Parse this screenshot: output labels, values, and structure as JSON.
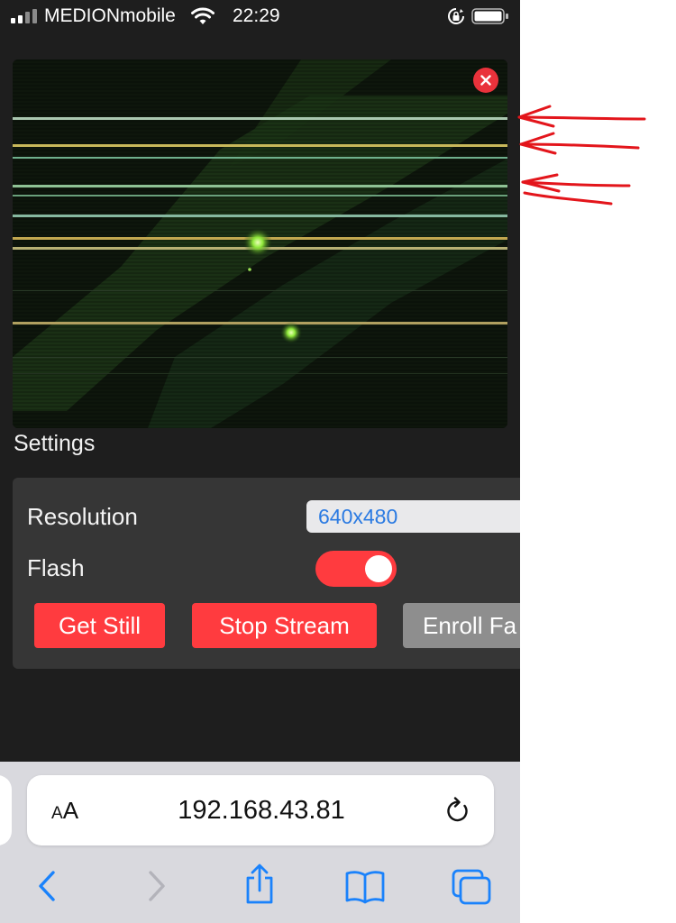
{
  "status_bar": {
    "carrier": "MEDIONmobile",
    "time": "22:29"
  },
  "settings": {
    "title": "Settings",
    "resolution_label": "Resolution",
    "resolution_value": "640x480",
    "flash_label": "Flash",
    "flash_on": true,
    "buttons": {
      "get_still": "Get Still",
      "stop_stream": "Stop Stream",
      "enroll_face": "Enroll Fa"
    }
  },
  "browser": {
    "text_size_label_small": "A",
    "text_size_label_large": "A",
    "url": "192.168.43.81"
  },
  "colors": {
    "accent_red": "#ff3b3f",
    "link_blue": "#2a7ae2",
    "ios_blue": "#1a82fb",
    "annotation_red": "#e3151b"
  },
  "icons": {
    "close": "close-icon",
    "back": "chevron-left-icon",
    "forward": "chevron-right-icon",
    "share": "share-icon",
    "bookmarks": "book-icon",
    "tabs": "tabs-icon",
    "reload": "reload-icon"
  }
}
